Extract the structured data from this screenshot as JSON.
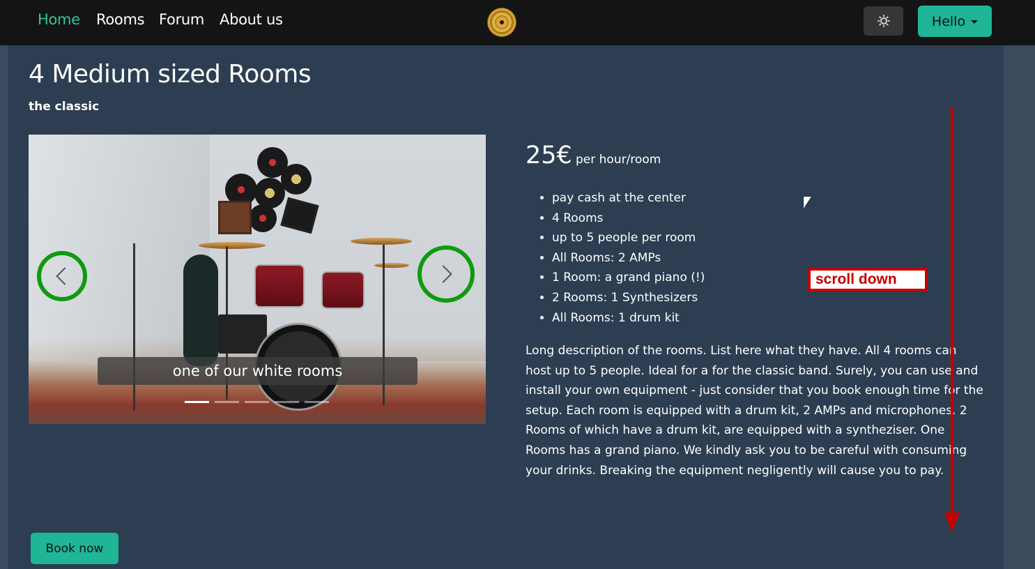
{
  "nav": {
    "links": [
      "Home",
      "Rooms",
      "Forum",
      "About us"
    ],
    "logo_icon": "vinyl-record-icon",
    "theme_icon": "sun-icon",
    "user_menu": "Hello"
  },
  "page": {
    "title": "4 Medium sized Rooms",
    "subtitle": "the classic"
  },
  "carousel": {
    "caption": "one of our white rooms",
    "slide_count": 5,
    "active_index": 0
  },
  "pricing": {
    "price": "25€",
    "unit": "per hour/room"
  },
  "features": [
    "pay cash at the center",
    "4 Rooms",
    "up to 5 people per room",
    "All Rooms: 2 AMPs",
    "1 Room: a grand piano (!)",
    "2 Rooms: 1 Synthesizers",
    "All Rooms: 1 drum kit"
  ],
  "description": "Long description of the rooms. List here what they have. All 4 rooms can host up to 5 people. Ideal for a for the classic band. Surely, you can use and install your own equipment - just consider that you book enough time for the setup. Each room is equipped with a drum kit, 2 AMPs and microphones. 2 Rooms of which have a drum kit, are equipped with a syntheziser. One Rooms has a grand piano. We kindly ask you to be careful with consuming your drinks. Breaking the equipment negligently will cause you to pay.",
  "actions": {
    "book_label": "Book now"
  },
  "annotation": {
    "label": "scroll down",
    "color": "#c40000"
  },
  "colors": {
    "accent": "#1fb596",
    "nav_active": "#36c3a0",
    "panel": "#2d3e52",
    "control_ring": "#0f9a10"
  }
}
